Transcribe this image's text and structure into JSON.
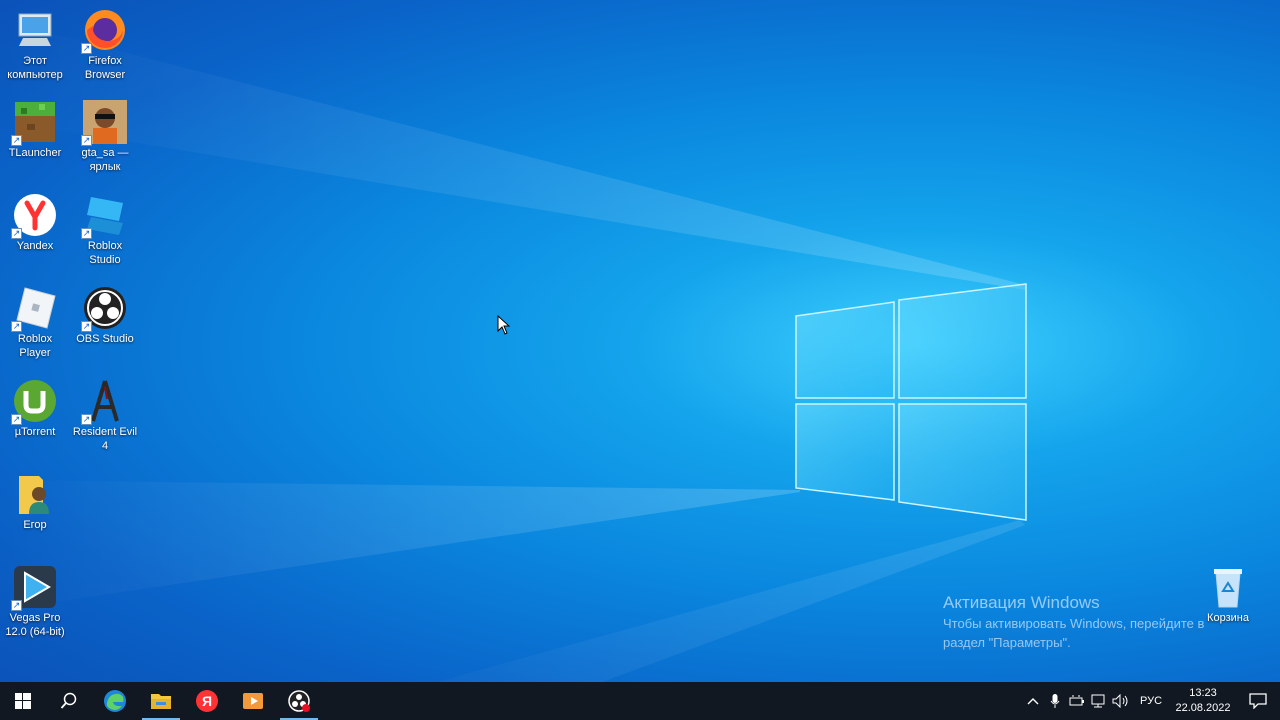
{
  "desktop": {
    "icons": [
      {
        "label": "Этот\nкомпьютер",
        "icon": "computer-icon"
      },
      {
        "label": "Firefox\nBrowser",
        "icon": "firefox-icon"
      },
      {
        "label": "TLauncher",
        "icon": "tlauncher-icon"
      },
      {
        "label": "gta_sa —\nярлык",
        "icon": "gta-sa-icon"
      },
      {
        "label": "Yandex",
        "icon": "yandex-icon"
      },
      {
        "label": "Roblox\nStudio",
        "icon": "roblox-studio-icon"
      },
      {
        "label": "Roblox\nPlayer",
        "icon": "roblox-player-icon"
      },
      {
        "label": "OBS Studio",
        "icon": "obs-icon"
      },
      {
        "label": "µTorrent",
        "icon": "utorrent-icon"
      },
      {
        "label": "Resident Evil\n4",
        "icon": "resident-evil-icon"
      },
      {
        "label": "Егор",
        "icon": "user-folder-icon"
      },
      {
        "label": "Vegas Pro\n12.0 (64-bit)",
        "icon": "vegas-pro-icon"
      },
      {
        "label": "Корзина",
        "icon": "recycle-bin-icon"
      }
    ]
  },
  "activation": {
    "title": "Активация Windows",
    "message": "Чтобы активировать Windows, перейдите в\nраздел \"Параметры\"."
  },
  "taskbar": {
    "apps": [
      "start-icon",
      "search-icon",
      "edge-icon",
      "file-explorer-icon",
      "yandex-browser-icon",
      "media-player-icon",
      "obs-recording-icon"
    ],
    "tray": {
      "language": "РУС",
      "time": "13:23",
      "date": "22.08.2022"
    }
  },
  "colors": {
    "accent": "#76b9ed",
    "taskbar": "#111821",
    "wallpaper": "#0a86de"
  }
}
